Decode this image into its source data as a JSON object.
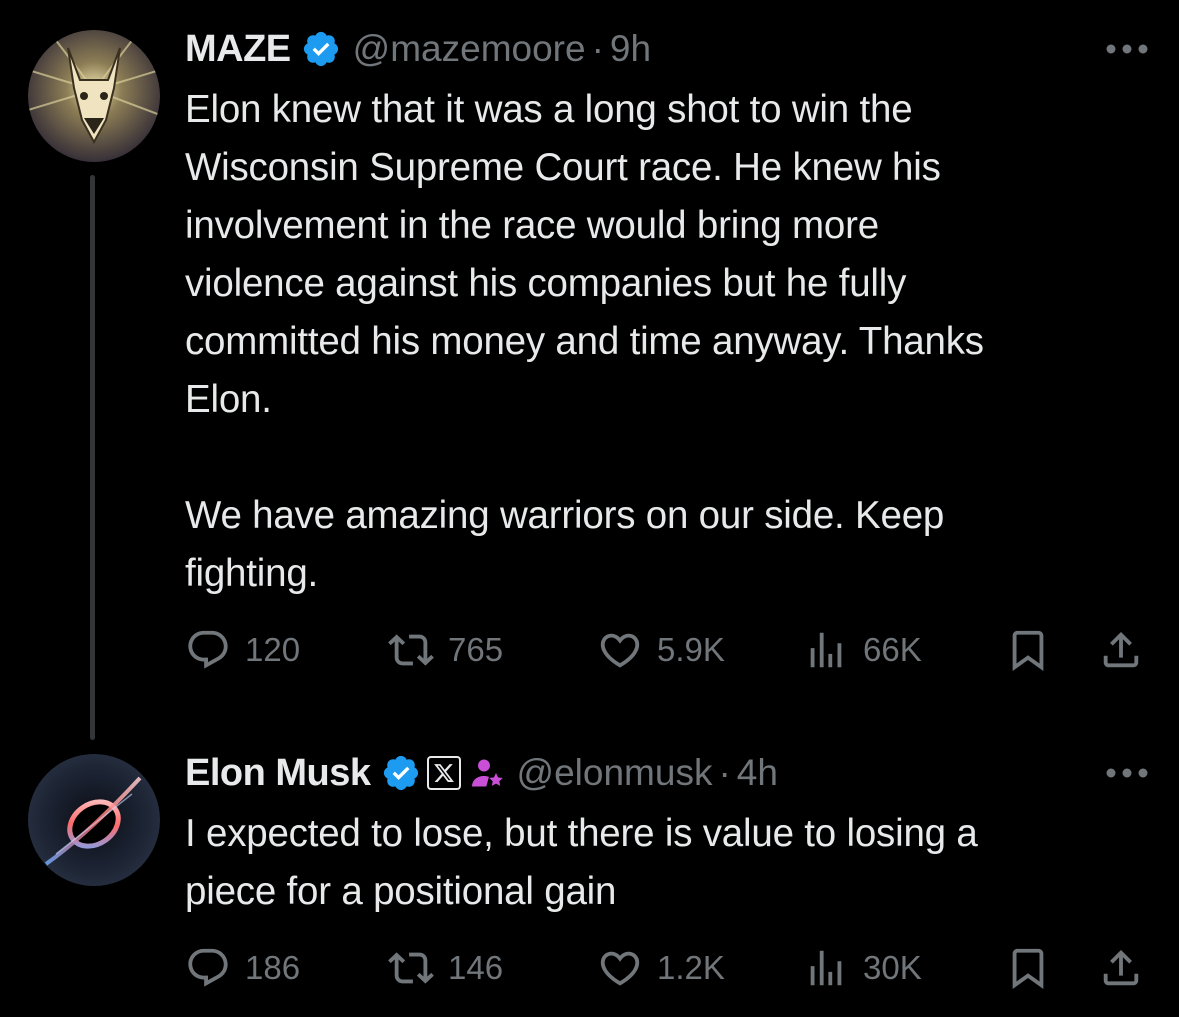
{
  "tweets": [
    {
      "display_name": "MAZE",
      "handle": "@mazemoore",
      "separator": "·",
      "time": "9h",
      "verified": true,
      "text": "Elon knew that it was a long shot to win the\nWisconsin Supreme Court race. He knew his\ninvolvement in the race would bring more\nviolence against his companies but he fully\ncommitted his money and time anyway. Thanks\nElon.\n\nWe have amazing warriors on our side. Keep\nfighting.",
      "stats": {
        "replies": "120",
        "retweets": "765",
        "likes": "5.9K",
        "views": "66K"
      },
      "icons": [
        "doberman-avatar",
        "verified-badge-icon",
        "more-icon",
        "reply-icon",
        "retweet-icon",
        "like-icon",
        "views-icon",
        "bookmark-icon",
        "share-icon"
      ]
    },
    {
      "display_name": "Elon Musk",
      "handle": "@elonmusk",
      "separator": "·",
      "time": "4h",
      "verified": true,
      "affiliate_badge": "𝕏",
      "text": "I expected to lose, but there is value to losing a\npiece for a positional gain",
      "stats": {
        "replies": "186",
        "retweets": "146",
        "likes": "1.2K",
        "views": "30K"
      },
      "icons": [
        "black-hole-avatar",
        "verified-badge-icon",
        "x-affiliate-badge",
        "government-person-icon",
        "more-icon",
        "reply-icon",
        "retweet-icon",
        "like-icon",
        "views-icon",
        "bookmark-icon",
        "share-icon"
      ]
    }
  ],
  "colors": {
    "background": "#000000",
    "text": "#e7e9ea",
    "secondary": "#71767b",
    "verified": "#1d9bf0",
    "gov_icon": "#c94fd6",
    "thread_line": "#333639"
  }
}
